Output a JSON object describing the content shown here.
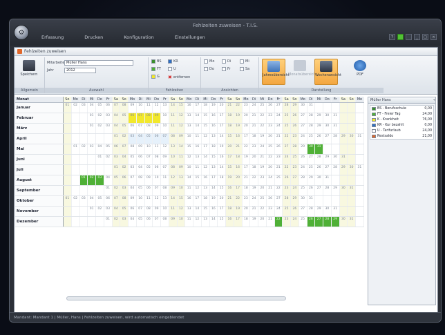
{
  "window": {
    "title": "Fehlzeiten zuweisen - T.I.S."
  },
  "menu": [
    "Erfassung",
    "Drucken",
    "Konfiguration",
    "Einstellungen"
  ],
  "inner_title": "Fehlzeiten zuweisen",
  "ribbon": {
    "save_label": "Speichern",
    "employee_label": "Mitarbeiter",
    "employee_value": "Müller Hans",
    "year_label": "Jahr",
    "year_value": "2012",
    "groups": [
      "Allgemein",
      "Auswahl",
      "Fehlzeiten",
      "Ansichten",
      "Darstellung"
    ],
    "absence_small": [
      "BS",
      "KR",
      "FT",
      "U",
      "G",
      "entfernen"
    ],
    "view_small": [
      "Mo",
      "Di",
      "Mi",
      "Do",
      "Fr",
      "Sa"
    ],
    "big_buttons": [
      "Jahresübersicht",
      "Monatsübersicht",
      "Wochenansicht",
      "Tagesansicht",
      "PDF"
    ]
  },
  "grid": {
    "month_header": "Monat",
    "day_names": [
      "So",
      "Mo",
      "Di",
      "Mi",
      "Do",
      "Fr",
      "Sa",
      "So",
      "Mo",
      "Di",
      "Mi",
      "Do",
      "Fr",
      "Sa",
      "So",
      "Mo",
      "Di",
      "Mi",
      "Do",
      "Fr",
      "Sa",
      "So",
      "Mo",
      "Di",
      "Mi",
      "Do",
      "Fr",
      "Sa",
      "So",
      "Mo",
      "Di",
      "Mi",
      "Do",
      "Fr",
      "Sa",
      "So",
      "Mo"
    ],
    "months": [
      "Januar",
      "Februar",
      "März",
      "April",
      "Mai",
      "Juni",
      "Juli",
      "August",
      "September",
      "Oktober",
      "November",
      "Dezember"
    ]
  },
  "legend_panel": {
    "title": "Müller Hans",
    "items": [
      {
        "label": "BS - Berufsschule",
        "value": "0,00"
      },
      {
        "label": "FT - Freier Tag",
        "value": "24,00"
      },
      {
        "label": "K - Krankheit",
        "value": "76,00"
      },
      {
        "label": "KR - Kur bezahlt",
        "value": "0,00"
      },
      {
        "label": "U - Tarifurlaub",
        "value": "24,00"
      },
      {
        "label": "Restsaldo",
        "value": "21,00"
      }
    ]
  },
  "status": "Mandant: Mandant 1 | Müller, Hans | Fehlzeiten zuweisen, wird automatisch eingeblendet",
  "colors": {
    "accent": "#f3a640",
    "green": "#4fb036",
    "yellow": "#f2e82c"
  }
}
